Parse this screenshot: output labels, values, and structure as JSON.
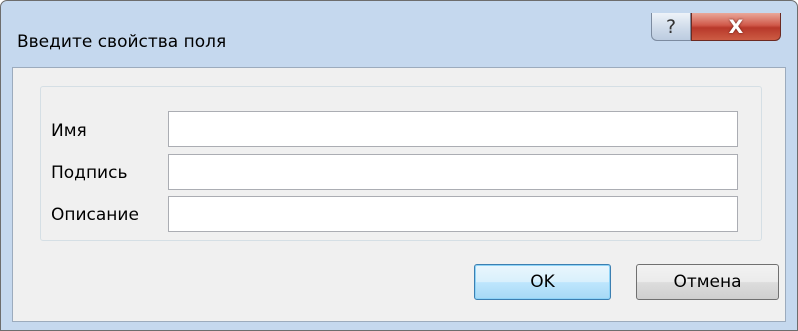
{
  "window": {
    "title": "Введите свойства поля",
    "help_glyph": "?",
    "close_glyph": "X"
  },
  "form": {
    "fields": [
      {
        "label": "Имя",
        "value": ""
      },
      {
        "label": "Подпись",
        "value": ""
      },
      {
        "label": "Описание",
        "value": ""
      }
    ]
  },
  "buttons": {
    "ok_label": "OK",
    "cancel_label": "Отмена"
  },
  "colors": {
    "frame": "#c5d8ee",
    "client": "#f0f0f0",
    "close_button": "#c7473a",
    "default_button_border": "#3c7fb1"
  },
  "icons": {
    "help": "help-icon",
    "close": "close-icon"
  }
}
